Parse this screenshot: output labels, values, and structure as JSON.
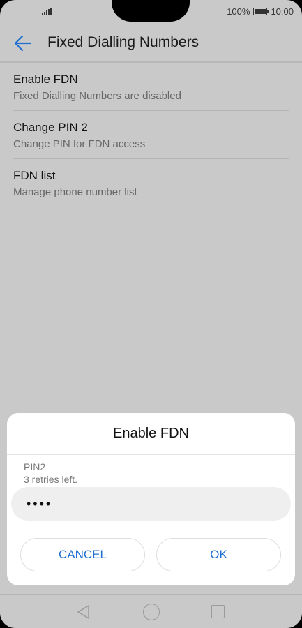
{
  "status_bar": {
    "battery_percent": "100%",
    "time": "10:00"
  },
  "app_bar": {
    "title": "Fixed Dialling Numbers"
  },
  "settings": [
    {
      "title": "Enable FDN",
      "subtitle": "Fixed Dialling Numbers are disabled"
    },
    {
      "title": "Change PIN 2",
      "subtitle": "Change PIN for FDN access"
    },
    {
      "title": "FDN list",
      "subtitle": "Manage phone number list"
    }
  ],
  "dialog": {
    "title": "Enable FDN",
    "field_label": "PIN2",
    "retries_text": "3 retries left.",
    "pin_value": "••••",
    "cancel_label": "CANCEL",
    "ok_label": "OK"
  },
  "colors": {
    "accent": "#1e6fd0",
    "background": "#c9c9c9"
  },
  "icons": {
    "back": "arrow-left-icon",
    "nav_back": "triangle-back-icon",
    "nav_home": "circle-home-icon",
    "nav_recent": "square-recent-icon"
  }
}
